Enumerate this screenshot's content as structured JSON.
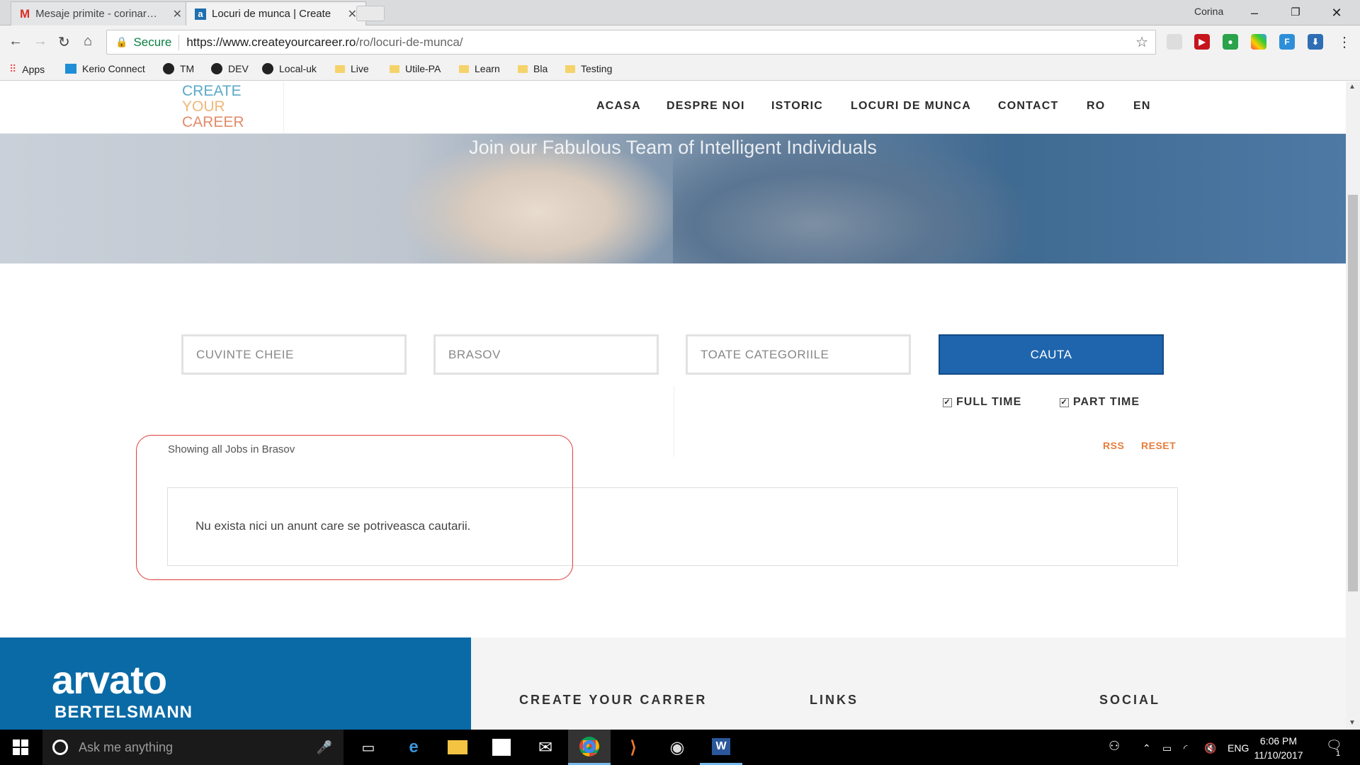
{
  "browser": {
    "tabs": [
      {
        "title": "Mesaje primite - corinar…",
        "active": false
      },
      {
        "title": "Locuri de munca | Create",
        "active": true
      }
    ],
    "user": "Corina",
    "secure_label": "Secure",
    "url_host": "https://www.createyourcareer.ro",
    "url_path": "/ro/locuri-de-munca/",
    "bookmarks": [
      "Apps",
      "Kerio Connect",
      "TM",
      "DEV",
      "Local-uk",
      "Live",
      "Utile-PA",
      "Learn",
      "Bla",
      "Testing"
    ]
  },
  "site": {
    "logo": {
      "line1": "CREATE",
      "line2": "YOUR",
      "line3": "CAREER"
    },
    "menu": [
      "ACASA",
      "DESPRE NOI",
      "ISTORIC",
      "LOCURI DE MUNCA",
      "CONTACT",
      "RO",
      "EN"
    ],
    "hero_subtitle": "Join our Fabulous Team of Intelligent Individuals",
    "search": {
      "keywords_placeholder": "CUVINTE CHEIE",
      "location_value": "BRASOV",
      "category_value": "TOATE CATEGORIILE",
      "button_label": "CAUTA"
    },
    "filters": [
      {
        "label": "FULL TIME",
        "checked": true
      },
      {
        "label": "PART TIME",
        "checked": true
      }
    ],
    "showing_text": "Showing all Jobs in Brasov",
    "links": {
      "rss": "RSS",
      "reset": "RESET"
    },
    "no_results": "Nu exista nici un anunt care se potriveasca cautarii.",
    "footer": {
      "brand": "arvato",
      "brand_sub": "BERTELSMANN",
      "col1": "CREATE YOUR CARRER",
      "col2": "LINKS",
      "col3": "SOCIAL"
    }
  },
  "taskbar": {
    "search_placeholder": "Ask me anything",
    "lang": "ENG",
    "time": "6:06 PM",
    "date": "11/10/2017",
    "notifications": "1"
  },
  "colors": {
    "primary_button": "#1e65ad",
    "link_orange": "#e67e3c",
    "footer_blue": "#0a6aa6",
    "highlight_red": "#e03b3b"
  }
}
